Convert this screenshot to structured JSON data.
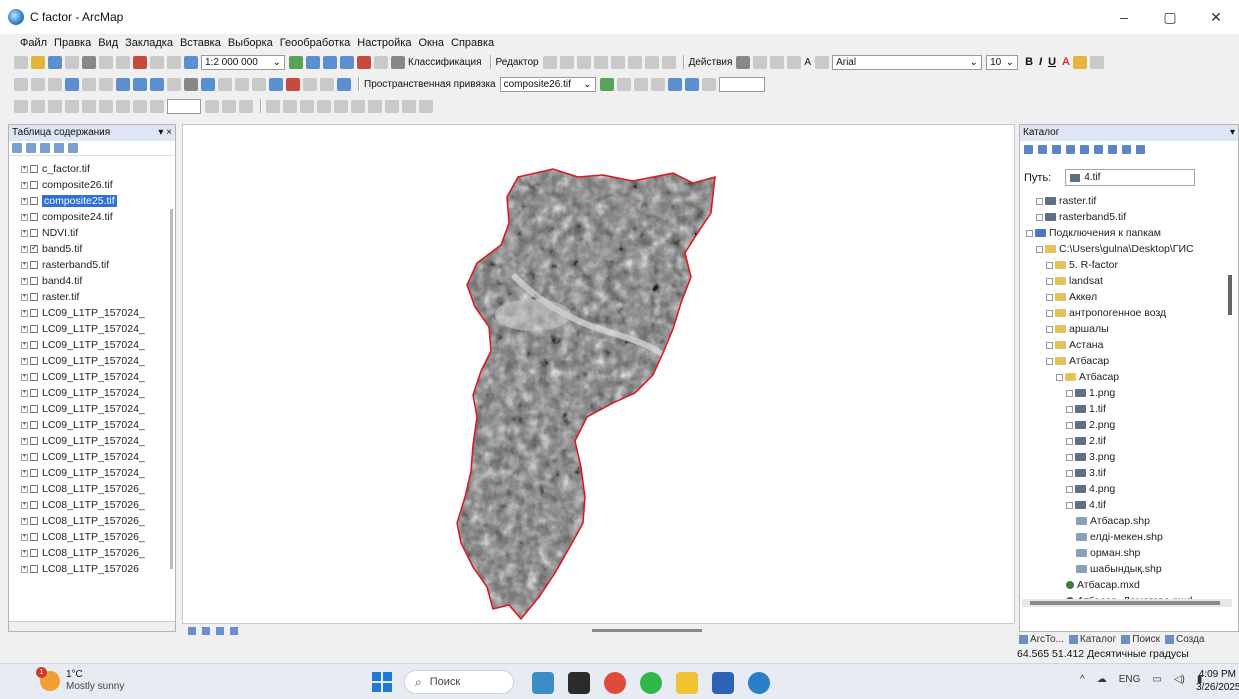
{
  "window": {
    "title": "C factor - ArcMap",
    "minimize": "–",
    "maximize": "▢",
    "close": "✕"
  },
  "menu": [
    "Файл",
    "Правка",
    "Вид",
    "Закладка",
    "Вставка",
    "Выборка",
    "Геообработка",
    "Настройка",
    "Окна",
    "Справка"
  ],
  "toolbar": {
    "scale": "1:2 000 000",
    "classification": "Классификация",
    "editor": "Редактор",
    "actions": "Действия",
    "font_name": "Arial",
    "font_size": "10",
    "snapping": "Пространственная привязка",
    "layer_select": "composite26.tif"
  },
  "toc": {
    "title": "Таблица содержания",
    "pin": "▾ ×",
    "layers": [
      {
        "name": "c_factor.tif",
        "checked": false,
        "selected": false
      },
      {
        "name": "composite26.tif",
        "checked": false,
        "selected": false
      },
      {
        "name": "composite25.tif",
        "checked": false,
        "selected": true
      },
      {
        "name": "composite24.tif",
        "checked": false,
        "selected": false
      },
      {
        "name": "NDVI.tif",
        "checked": false,
        "selected": false
      },
      {
        "name": "band5.tif",
        "checked": true,
        "selected": false
      },
      {
        "name": "rasterband5.tif",
        "checked": false,
        "selected": false
      },
      {
        "name": "band4.tif",
        "checked": false,
        "selected": false
      },
      {
        "name": "raster.tif",
        "checked": false,
        "selected": false
      },
      {
        "name": "LC09_L1TP_157024_",
        "checked": false,
        "selected": false
      },
      {
        "name": "LC09_L1TP_157024_",
        "checked": false,
        "selected": false
      },
      {
        "name": "LC09_L1TP_157024_",
        "checked": false,
        "selected": false
      },
      {
        "name": "LC09_L1TP_157024_",
        "checked": false,
        "selected": false
      },
      {
        "name": "LC09_L1TP_157024_",
        "checked": false,
        "selected": false
      },
      {
        "name": "LC09_L1TP_157024_",
        "checked": false,
        "selected": false
      },
      {
        "name": "LC09_L1TP_157024_",
        "checked": false,
        "selected": false
      },
      {
        "name": "LC09_L1TP_157024_",
        "checked": false,
        "selected": false
      },
      {
        "name": "LC09_L1TP_157024_",
        "checked": false,
        "selected": false
      },
      {
        "name": "LC09_L1TP_157024_",
        "checked": false,
        "selected": false
      },
      {
        "name": "LC09_L1TP_157024_",
        "checked": false,
        "selected": false
      },
      {
        "name": "LC08_L1TP_157026_",
        "checked": false,
        "selected": false
      },
      {
        "name": "LC08_L1TP_157026_",
        "checked": false,
        "selected": false
      },
      {
        "name": "LC08_L1TP_157026_",
        "checked": false,
        "selected": false
      },
      {
        "name": "LC08_L1TP_157026_",
        "checked": false,
        "selected": false
      },
      {
        "name": "LC08_L1TP_157026_",
        "checked": false,
        "selected": false
      },
      {
        "name": "LC08_L1TP_157026",
        "checked": false,
        "selected": false
      }
    ]
  },
  "catalog": {
    "title": "Каталог",
    "path_label": "Путь:",
    "path_value": "4.tif",
    "items": [
      {
        "label": "raster.tif",
        "indent": 1,
        "icon": "raster",
        "exp": true
      },
      {
        "label": "rasterband5.tif",
        "indent": 1,
        "icon": "raster",
        "exp": true
      },
      {
        "label": "Подключения к папкам",
        "indent": 0,
        "icon": "conn",
        "exp": true
      },
      {
        "label": "C:\\Users\\gulna\\Desktop\\ГИС",
        "indent": 1,
        "icon": "folder",
        "exp": true
      },
      {
        "label": "5. R-factor",
        "indent": 2,
        "icon": "folder",
        "exp": true
      },
      {
        "label": "landsat",
        "indent": 2,
        "icon": "folder",
        "exp": true
      },
      {
        "label": "Аккөл",
        "indent": 2,
        "icon": "folder",
        "exp": true
      },
      {
        "label": "антропогенное возд",
        "indent": 2,
        "icon": "folder",
        "exp": true
      },
      {
        "label": "аршалы",
        "indent": 2,
        "icon": "folder",
        "exp": true
      },
      {
        "label": "Астана",
        "indent": 2,
        "icon": "folder",
        "exp": true
      },
      {
        "label": "Атбасар",
        "indent": 2,
        "icon": "folder",
        "exp": true
      },
      {
        "label": "Атбасар",
        "indent": 3,
        "icon": "folder",
        "exp": true
      },
      {
        "label": "1.png",
        "indent": 4,
        "icon": "raster",
        "exp": true
      },
      {
        "label": "1.tif",
        "indent": 4,
        "icon": "raster",
        "exp": true
      },
      {
        "label": "2.png",
        "indent": 4,
        "icon": "raster",
        "exp": true
      },
      {
        "label": "2.tif",
        "indent": 4,
        "icon": "raster",
        "exp": true
      },
      {
        "label": "3.png",
        "indent": 4,
        "icon": "raster",
        "exp": true
      },
      {
        "label": "3.tif",
        "indent": 4,
        "icon": "raster",
        "exp": true
      },
      {
        "label": "4.png",
        "indent": 4,
        "icon": "raster",
        "exp": true
      },
      {
        "label": "4.tif",
        "indent": 4,
        "icon": "raster",
        "exp": true
      },
      {
        "label": "Атбасар.shp",
        "indent": 5,
        "icon": "shp",
        "exp": false
      },
      {
        "label": "елді-мекен.shp",
        "indent": 5,
        "icon": "shp",
        "exp": false
      },
      {
        "label": "орман.shp",
        "indent": 5,
        "icon": "shp",
        "exp": false
      },
      {
        "label": "шабындық.shp",
        "indent": 5,
        "icon": "shp",
        "exp": false
      },
      {
        "label": "Атбасар.mxd",
        "indent": 4,
        "icon": "mxd",
        "exp": false
      },
      {
        "label": "Атбасар_Дамегова.mxd",
        "indent": 4,
        "icon": "mxd",
        "exp": false
      }
    ],
    "tabs": [
      "ArcTo...",
      "Каталог",
      "Поиск",
      "Созда"
    ]
  },
  "status": {
    "coords": "64.565  51.412 Десятичные градусы"
  },
  "taskbar": {
    "temp": "1°C",
    "condition": "Mostly sunny",
    "weather_badge": "1",
    "search": "Поиск",
    "lang": "ENG",
    "time": "4:09 PM",
    "date": "3/26/2025"
  }
}
